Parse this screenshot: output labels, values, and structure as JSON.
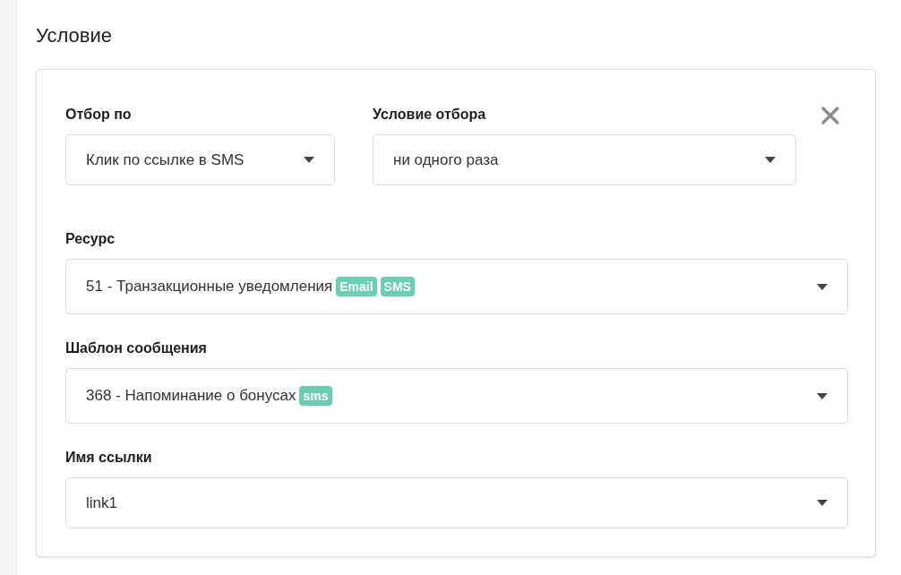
{
  "heading": "Условие",
  "top_row": [
    {
      "label": "Отбор по",
      "value": "Клик по ссылке в SMS"
    },
    {
      "label": "Условие отбора",
      "value": "ни одного раза"
    }
  ],
  "fields": [
    {
      "label": "Ресурс",
      "value": "51 - Транзакционные уведомления",
      "tags": [
        "Email",
        "SMS"
      ]
    },
    {
      "label": "Шаблон сообщения",
      "value": "368 - Напоминание о бонусах",
      "tags": [
        "sms"
      ]
    },
    {
      "label": "Имя ссылки",
      "value": "link1"
    }
  ]
}
